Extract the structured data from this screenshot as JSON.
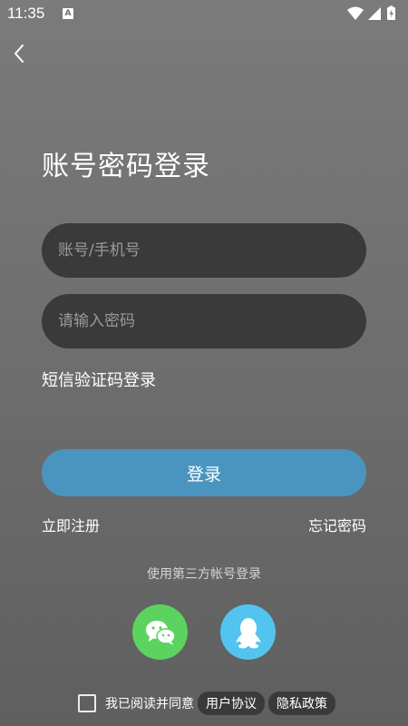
{
  "status_bar": {
    "time": "11:35",
    "indicator_letter": "A"
  },
  "title": "账号密码登录",
  "account_input": {
    "placeholder": "账号/手机号",
    "value": ""
  },
  "password_input": {
    "placeholder": "请输入密码",
    "value": ""
  },
  "sms_login_label": "短信验证码登录",
  "login_button_label": "登录",
  "register_label": "立即注册",
  "forgot_password_label": "忘记密码",
  "third_party_caption": "使用第三方帐号登录",
  "social": {
    "wechat_icon": "wechat-icon",
    "qq_icon": "qq-icon",
    "wechat_color": "#5cd35f",
    "qq_color": "#53c4f0"
  },
  "agreement": {
    "text": "我已阅读并同意",
    "user_agreement": "用户协议",
    "privacy_policy": "隐私政策",
    "checked": false
  },
  "colors": {
    "accent": "#4a95bf",
    "input_bg": "#3a3a3a"
  }
}
